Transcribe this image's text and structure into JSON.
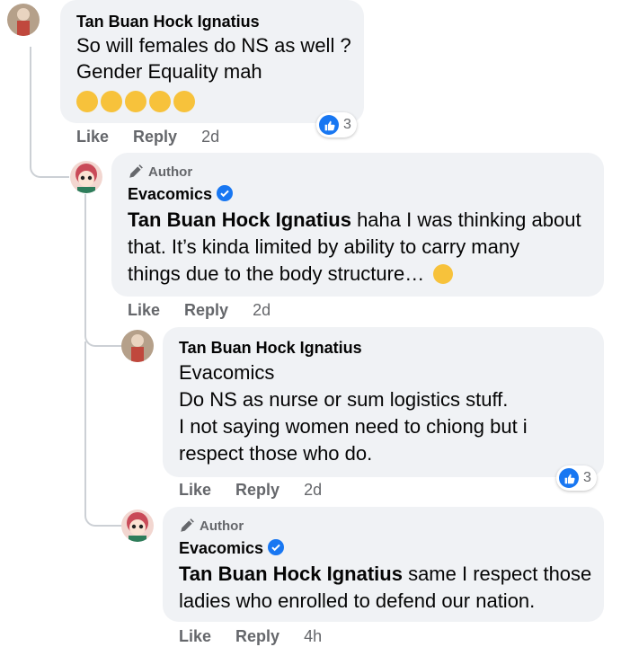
{
  "comments": [
    {
      "author": "Tan Buan Hock Ignatius",
      "lines": [
        "So will females do NS as well ?",
        "Gender Equality mah"
      ],
      "emoji_count": 5,
      "actions": {
        "like": "Like",
        "reply": "Reply",
        "time": "2d"
      },
      "reactions": "3"
    },
    {
      "badge": "Author",
      "author": "Evacomics",
      "mention": "Tan Buan Hock Ignatius",
      "lines": [
        " haha I was thinking about",
        "that. It’s kinda limited by ability to carry many",
        "things due to the body structure…"
      ],
      "actions": {
        "like": "Like",
        "reply": "Reply",
        "time": "2d"
      }
    },
    {
      "author": "Tan Buan Hock Ignatius",
      "mention": "Evacomics",
      "lines": [
        "Do NS as nurse or sum logistics stuff.",
        "I not saying women need to chiong but i",
        "respect those who do."
      ],
      "actions": {
        "like": "Like",
        "reply": "Reply",
        "time": "2d"
      },
      "reactions": "3"
    },
    {
      "badge": "Author",
      "author": "Evacomics",
      "mention": "Tan Buan Hock Ignatius",
      "lines": [
        " same I respect those",
        "ladies who enrolled to defend our nation."
      ],
      "actions": {
        "like": "Like",
        "reply": "Reply",
        "time": "4h"
      }
    }
  ],
  "colors": {
    "bubble": "#f0f2f5",
    "accent": "#1877f2",
    "muted": "#65676b"
  }
}
